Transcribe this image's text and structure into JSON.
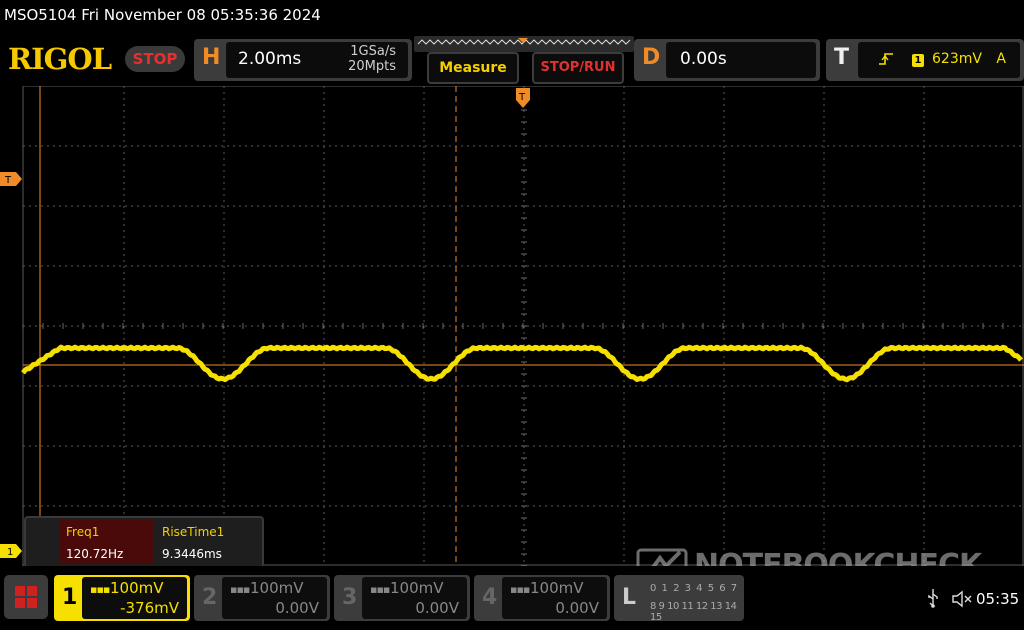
{
  "title_bar": {
    "text": "MSO5104  Fri November 08 05:35:36 2024"
  },
  "header": {
    "logo": "RIGOL",
    "run_state": "STOP",
    "horizontal": {
      "letter": "H",
      "timebase": "2.00ms",
      "sample_rate": "1GSa/s",
      "memory_depth": "20Mpts"
    },
    "measure_label": "Measure",
    "stop_run_label": "STOP/RUN",
    "delay": {
      "letter": "D",
      "value": "0.00s"
    },
    "trigger": {
      "letter": "T",
      "source_badge": "1",
      "level": "623mV",
      "mode": "A"
    }
  },
  "markers": {
    "trigger_pos_marker": "T",
    "trigger_level_marker": "T",
    "ch1_ground_marker": "1"
  },
  "measurements": [
    {
      "label": "Freq1",
      "value": "120.72Hz"
    },
    {
      "label": "RiseTime1",
      "value": "9.3446ms"
    }
  ],
  "channels": [
    {
      "number": "1",
      "scale": "100mV",
      "offset": "-376mV",
      "active": true
    },
    {
      "number": "2",
      "scale": "100mV",
      "offset": "0.00V",
      "active": false
    },
    {
      "number": "3",
      "scale": "100mV",
      "offset": "0.00V",
      "active": false
    },
    {
      "number": "4",
      "scale": "100mV",
      "offset": "0.00V",
      "active": false
    }
  ],
  "logic_analyzer": {
    "letter": "L",
    "row1": "0 1 2 3 4 5 6 7",
    "row2": "8 9 10 11 12 13 14 15"
  },
  "watermark": "NOTEBOOKCHECK",
  "status": {
    "clock": "05:35"
  },
  "icons": {
    "menu": "grid-menu-icon",
    "trigger_edge": "rising-edge-icon",
    "usb": "usb-icon",
    "speaker": "speaker-muted-icon"
  },
  "colors": {
    "ch1": "#f5e000",
    "accent_orange": "#f08c28",
    "stop_red": "#e53030",
    "panel_gray": "#3c3c3c"
  }
}
